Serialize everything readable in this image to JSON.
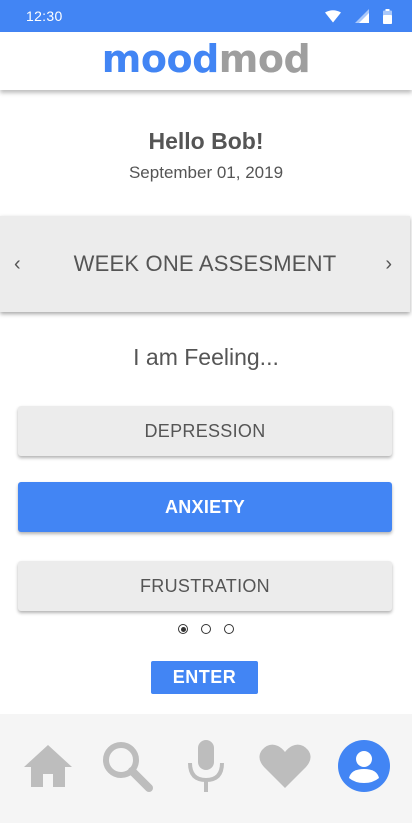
{
  "status_bar": {
    "time": "12:30",
    "icons": [
      "wifi-icon",
      "signal-icon",
      "battery-icon"
    ],
    "color": "#4285f4"
  },
  "header": {
    "logo_part_a": "mood",
    "logo_part_b": "mod"
  },
  "greeting": {
    "hello": "Hello Bob!",
    "date": "September 01, 2019"
  },
  "week_banner": {
    "title": "WEEK ONE ASSESMENT",
    "prev_icon": "‹",
    "next_icon": "›"
  },
  "feeling_prompt": "I am Feeling...",
  "moods": [
    {
      "label": "DEPRESSION",
      "selected": false
    },
    {
      "label": "ANXIETY",
      "selected": true
    },
    {
      "label": "FRUSTRATION",
      "selected": false
    }
  ],
  "pager": {
    "pages": 3,
    "active": 1
  },
  "enter_label": "ENTER",
  "bottom_nav": {
    "items": [
      {
        "icon": "home-icon",
        "active": false
      },
      {
        "icon": "search-icon",
        "active": false
      },
      {
        "icon": "microphone-icon",
        "active": false
      },
      {
        "icon": "heart-icon",
        "active": false
      },
      {
        "icon": "profile-icon",
        "active": true
      }
    ]
  },
  "colors": {
    "accent": "#4285f4",
    "muted": "#9e9e9e",
    "text": "#555555",
    "button_gray": "#ececec"
  }
}
